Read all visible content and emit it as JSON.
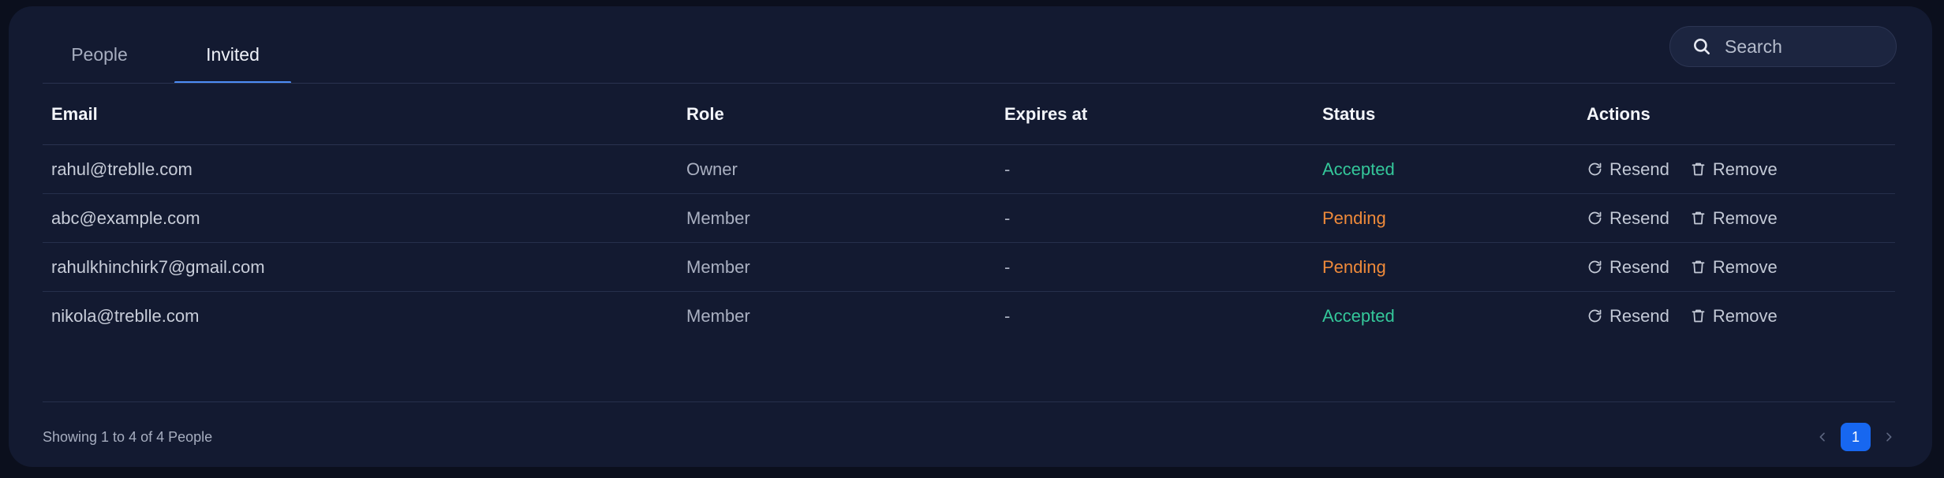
{
  "tabs": [
    {
      "label": "People",
      "active": false
    },
    {
      "label": "Invited",
      "active": true
    }
  ],
  "search": {
    "placeholder": "Search",
    "icon": "search-icon"
  },
  "table": {
    "headers": {
      "email": "Email",
      "role": "Role",
      "expires": "Expires at",
      "status": "Status",
      "actions": "Actions"
    },
    "rows": [
      {
        "email": "rahul@treblle.com",
        "role": "Owner",
        "expires": "-",
        "status": "Accepted"
      },
      {
        "email": "abc@example.com",
        "role": "Member",
        "expires": "-",
        "status": "Pending"
      },
      {
        "email": "rahulkhinchirk7@gmail.com",
        "role": "Member",
        "expires": "-",
        "status": "Pending"
      },
      {
        "email": "nikola@treblle.com",
        "role": "Member",
        "expires": "-",
        "status": "Accepted"
      }
    ],
    "actions": {
      "resend": "Resend",
      "remove": "Remove",
      "resend_icon": "refresh-icon",
      "remove_icon": "trash-icon"
    }
  },
  "footer": {
    "showing": "Showing 1 to 4 of 4 People",
    "current_page": "1"
  },
  "colors": {
    "accent": "#1767f0",
    "tab_underline": "#4d8df6",
    "accepted": "#34c79a",
    "pending": "#ef8a3a",
    "panel": "#131a31",
    "background": "#0b0f1d"
  }
}
